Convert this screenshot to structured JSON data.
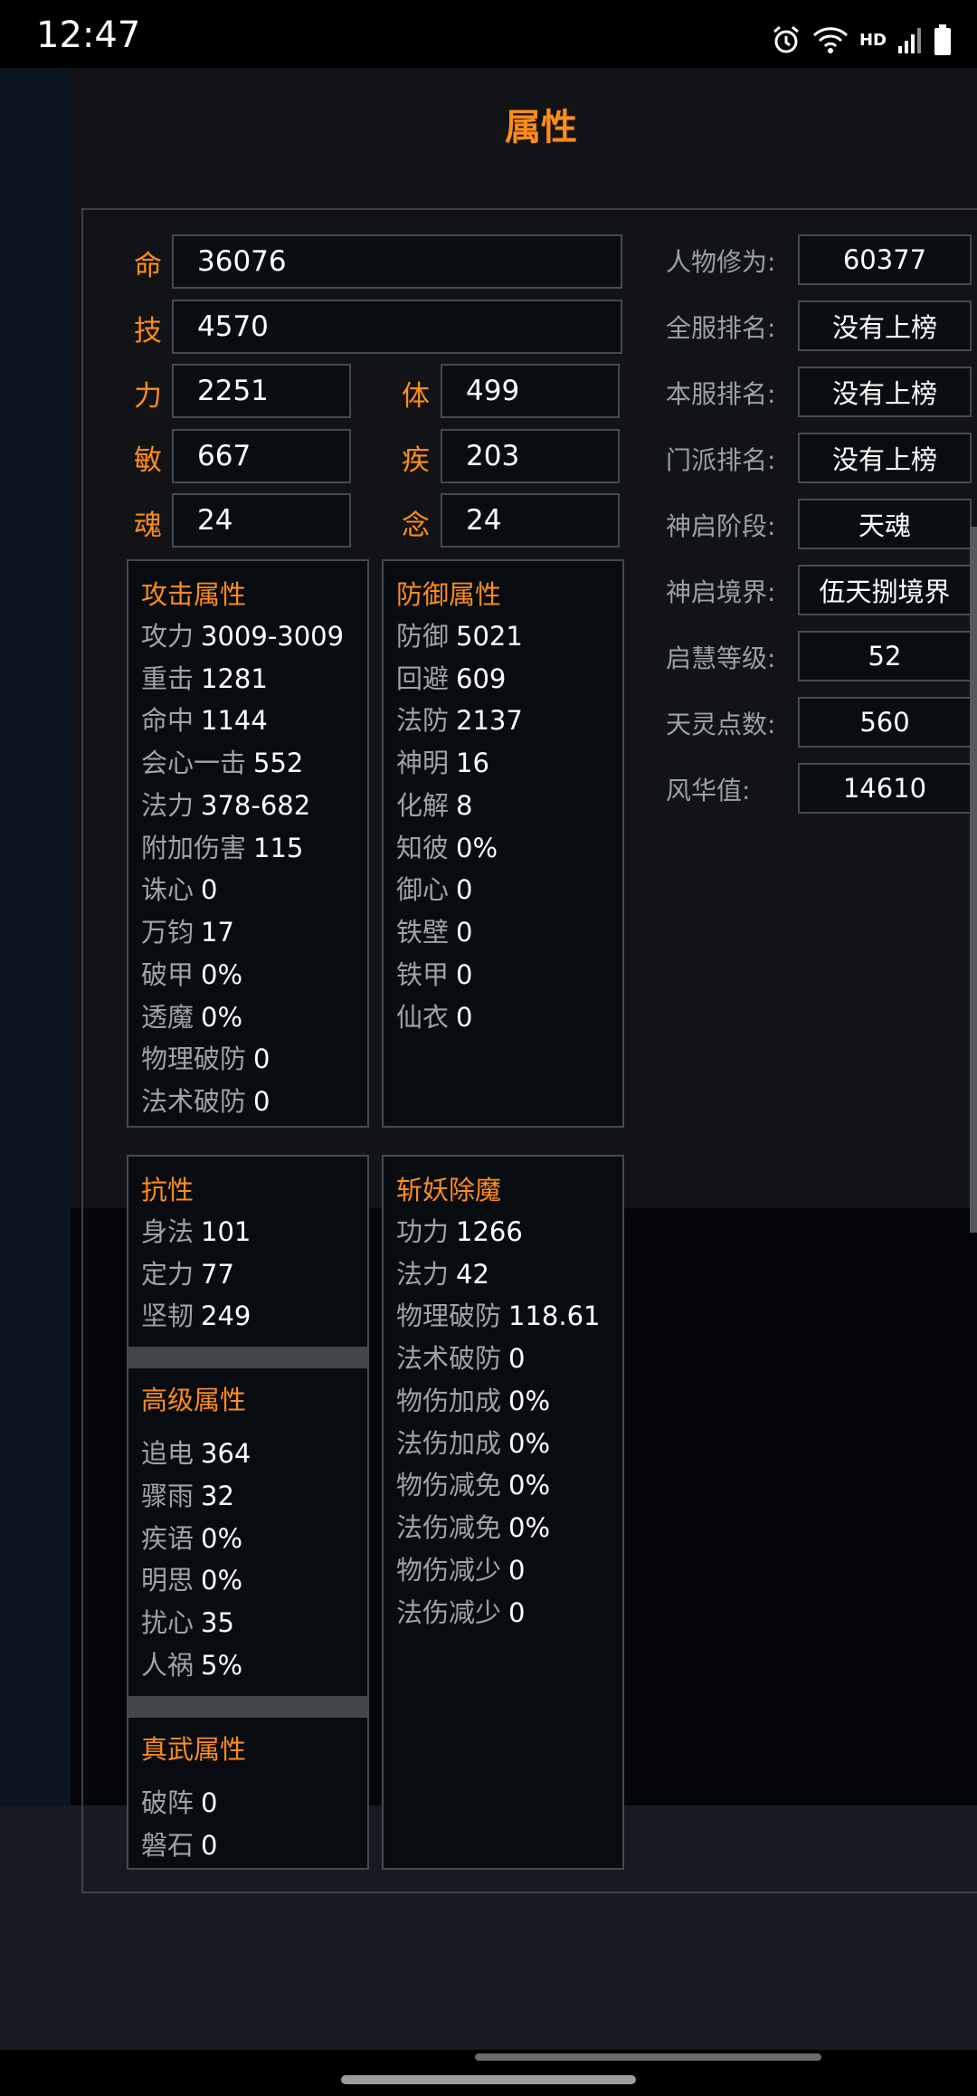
{
  "status": {
    "time": "12:47",
    "hd": "HD"
  },
  "title": "属性",
  "base": {
    "ming": {
      "label": "命",
      "value": "36076"
    },
    "ji": {
      "label": "技",
      "value": "4570"
    },
    "li": {
      "label": "力",
      "value": "2251"
    },
    "ti": {
      "label": "体",
      "value": "499"
    },
    "min": {
      "label": "敏",
      "value": "667"
    },
    "jibing": {
      "label": "疾",
      "value": "203"
    },
    "hun": {
      "label": "魂",
      "value": "24"
    },
    "nian": {
      "label": "念",
      "value": "24"
    }
  },
  "info": [
    {
      "label": "人物修为:",
      "value": "60377"
    },
    {
      "label": "全服排名:",
      "value": "没有上榜"
    },
    {
      "label": "本服排名:",
      "value": "没有上榜"
    },
    {
      "label": "门派排名:",
      "value": "没有上榜"
    },
    {
      "label": "神启阶段:",
      "value": "天魂"
    },
    {
      "label": "神启境界:",
      "value": "伍天捌境界"
    },
    {
      "label": "启慧等级:",
      "value": "52"
    },
    {
      "label": "天灵点数:",
      "value": "560"
    },
    {
      "label": "风华值:",
      "value": "14610"
    }
  ],
  "attack": {
    "title": "攻击属性",
    "rows": [
      {
        "k": "攻力",
        "v": "3009-3009"
      },
      {
        "k": "重击",
        "v": "1281"
      },
      {
        "k": "命中",
        "v": "1144"
      },
      {
        "k": "会心一击",
        "v": "552"
      },
      {
        "k": "法力",
        "v": "378-682"
      },
      {
        "k": "附加伤害",
        "v": "115"
      },
      {
        "k": "诛心",
        "v": "0"
      },
      {
        "k": "万钧",
        "v": "17"
      },
      {
        "k": "破甲",
        "v": "0%"
      },
      {
        "k": "透魔",
        "v": "0%"
      },
      {
        "k": "物理破防",
        "v": "0"
      },
      {
        "k": "法术破防",
        "v": "0"
      }
    ]
  },
  "defense": {
    "title": "防御属性",
    "rows": [
      {
        "k": "防御",
        "v": "5021"
      },
      {
        "k": "回避",
        "v": "609"
      },
      {
        "k": "法防",
        "v": "2137"
      },
      {
        "k": "神明",
        "v": "16"
      },
      {
        "k": "化解",
        "v": "8"
      },
      {
        "k": "知彼",
        "v": "0%"
      },
      {
        "k": "御心",
        "v": "0"
      },
      {
        "k": "铁壁",
        "v": "0"
      },
      {
        "k": "铁甲",
        "v": "0"
      },
      {
        "k": "仙衣",
        "v": "0"
      }
    ]
  },
  "resist": {
    "title": "抗性",
    "rows": [
      {
        "k": "身法",
        "v": "101"
      },
      {
        "k": "定力",
        "v": "77"
      },
      {
        "k": "坚韧",
        "v": "249"
      }
    ]
  },
  "advanced": {
    "title": "高级属性",
    "rows": [
      {
        "k": "追电",
        "v": "364"
      },
      {
        "k": "骤雨",
        "v": "32"
      },
      {
        "k": "疾语",
        "v": "0%"
      },
      {
        "k": "明思",
        "v": "0%"
      },
      {
        "k": "扰心",
        "v": "35"
      },
      {
        "k": "人祸",
        "v": "5%"
      }
    ]
  },
  "zhenwu": {
    "title": "真武属性",
    "rows": [
      {
        "k": "破阵",
        "v": "0"
      },
      {
        "k": "磐石",
        "v": "0"
      }
    ]
  },
  "demon": {
    "title": "斩妖除魔",
    "rows": [
      {
        "k": "功力",
        "v": "1266"
      },
      {
        "k": "法力",
        "v": "42"
      },
      {
        "k": "物理破防",
        "v": "118.61"
      },
      {
        "k": "法术破防",
        "v": "0"
      },
      {
        "k": "物伤加成",
        "v": "0%"
      },
      {
        "k": "法伤加成",
        "v": "0%"
      },
      {
        "k": "物伤减免",
        "v": "0%"
      },
      {
        "k": "法伤减免",
        "v": "0%"
      },
      {
        "k": "物伤减少",
        "v": "0"
      },
      {
        "k": "法伤减少",
        "v": "0"
      }
    ]
  }
}
